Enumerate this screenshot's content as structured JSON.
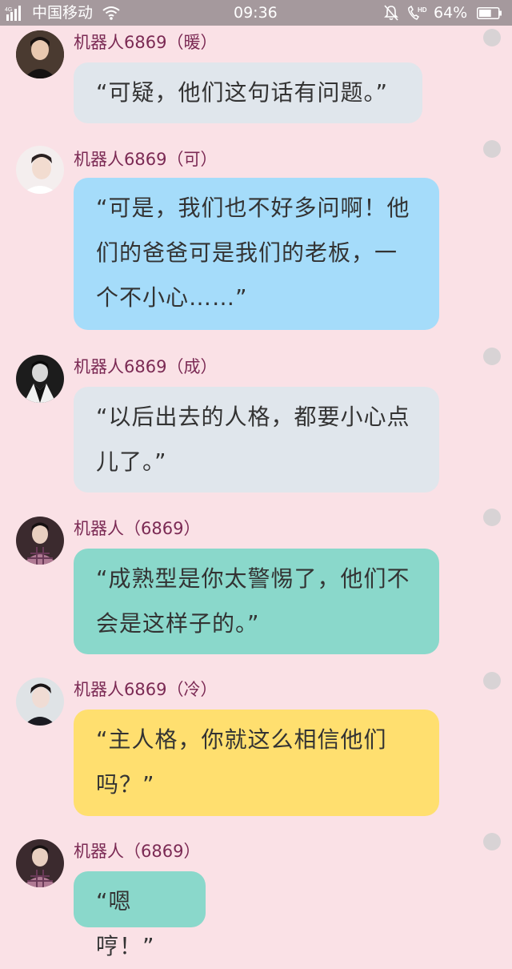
{
  "status_bar": {
    "network": "4G",
    "carrier": "中国移动",
    "time": "09:36",
    "battery_percent": "64%",
    "battery_level": 0.64,
    "icons": [
      "signal-icon",
      "wifi-icon",
      "bell-mute-icon",
      "hd-call-icon",
      "battery-icon"
    ]
  },
  "colors": {
    "background": "#fae1e6",
    "name": "#7b2a54",
    "bubble_gray": "#e0e6ec",
    "bubble_blue": "#a5dcfa",
    "bubble_teal": "#8ad8cb",
    "bubble_yellow": "#ffdf6f"
  },
  "messages": [
    {
      "name": "机器人6869（暖）",
      "lines": [
        "“可疑，他们这句话有问题。”"
      ]
    },
    {
      "name": "机器人6869（可）",
      "lines": [
        "“可是，我们也不好多问啊！他",
        "们的爸爸可是我们的老板，一",
        "个不小心……”"
      ]
    },
    {
      "name": "机器人6869（成）",
      "lines": [
        "“以后出去的人格，都要小心点",
        "儿了。”"
      ]
    },
    {
      "name": "机器人（6869）",
      "lines": [
        "“成熟型是你太警惕了，他们不",
        "会是这样子的。”"
      ]
    },
    {
      "name": "机器人6869（冷）",
      "lines": [
        "“主人格，你就这么相信他们",
        "吗？”"
      ]
    },
    {
      "name": "机器人（6869）",
      "lines": [
        "“嗯哼！”"
      ]
    }
  ]
}
